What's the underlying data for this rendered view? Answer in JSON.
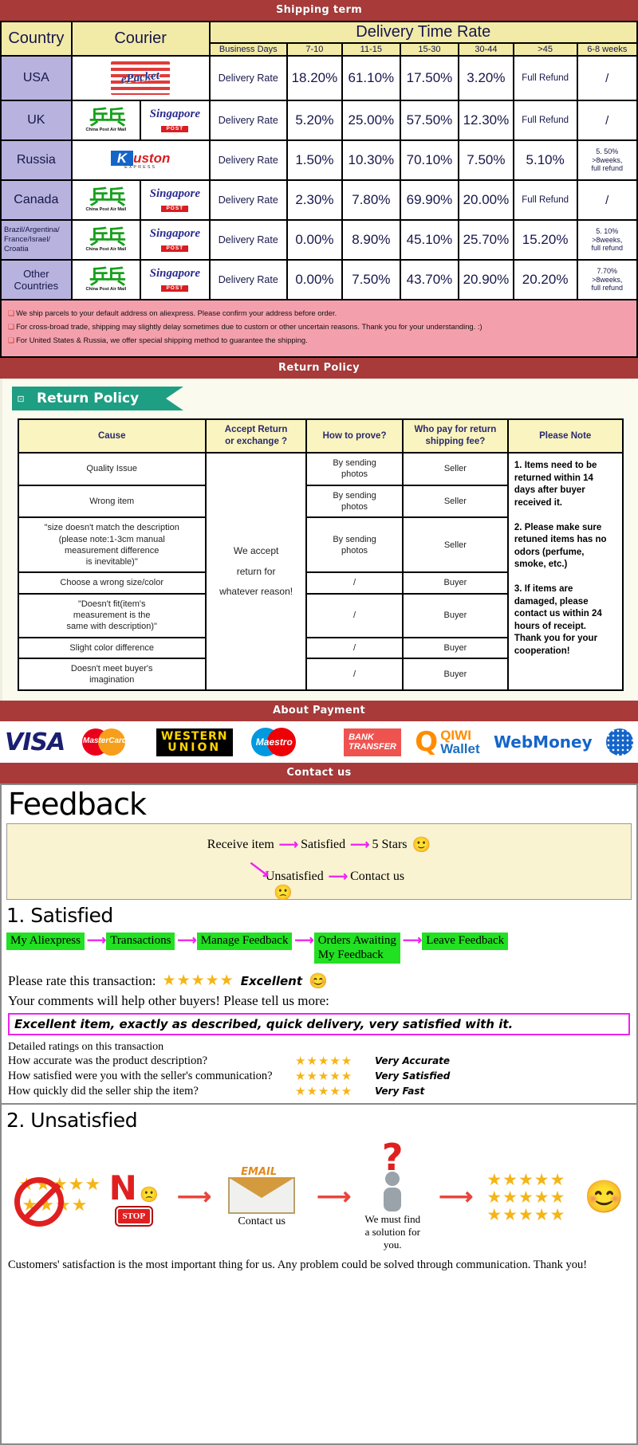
{
  "sections": {
    "shipping_banner": "Shipping term",
    "return_banner": "Return Policy",
    "payment_banner": "About Payment",
    "contact_banner": "Contact us"
  },
  "shipping": {
    "headers": {
      "country": "Country",
      "courier": "Courier",
      "delivery_time_rate": "Delivery Time Rate",
      "business_days": "Business Days",
      "d1": "7-10",
      "d2": "11-15",
      "d3": "15-30",
      "d4": "30-44",
      "d5": ">45",
      "d6": "6-8 weeks"
    },
    "rate_label": "Delivery Rate",
    "rows": [
      {
        "country": "USA",
        "couriers": [
          "epacket"
        ],
        "values": [
          "18.20%",
          "61.10%",
          "17.50%",
          "3.20%",
          "Full Refund",
          "/"
        ]
      },
      {
        "country": "UK",
        "couriers": [
          "china-post-air-mail",
          "singapore-post"
        ],
        "values": [
          "5.20%",
          "25.00%",
          "57.50%",
          "12.30%",
          "Full Refund",
          "/"
        ]
      },
      {
        "country": "Russia",
        "couriers": [
          "kuston-express"
        ],
        "values": [
          "1.50%",
          "10.30%",
          "70.10%",
          "7.50%",
          "5.10%",
          "5. 50%\n>8weeks,\nfull refund"
        ]
      },
      {
        "country": "Canada",
        "couriers": [
          "china-post-air-mail",
          "singapore-post"
        ],
        "values": [
          "2.30%",
          "7.80%",
          "69.90%",
          "20.00%",
          "Full Refund",
          "/"
        ]
      },
      {
        "country": "Brazil/Argentina/\nFrance/Israel/\nCroatia",
        "couriers": [
          "china-post-air-mail",
          "singapore-post"
        ],
        "values": [
          "0.00%",
          "8.90%",
          "45.10%",
          "25.70%",
          "15.20%",
          "5. 10%\n>8weeks,\nfull refund"
        ]
      },
      {
        "country": "Other Countries",
        "couriers": [
          "china-post-air-mail",
          "singapore-post"
        ],
        "values": [
          "0.00%",
          "7.50%",
          "43.70%",
          "20.90%",
          "20.20%",
          "7.70%\n>8weeks,\nfull refund"
        ]
      }
    ],
    "notice": [
      "We ship parcels to your default address on aliexpress. Please confirm your address before order.",
      "For cross-broad trade, shipping may slightly delay sometimes due to custom or other uncertain reasons. Thank you for your understanding. :)",
      "For United States & Russia, we offer special shipping method to guarantee the shipping."
    ]
  },
  "return_policy": {
    "tab_label": "Return Policy",
    "headers": [
      "Cause",
      "Accept Return\nor exchange ?",
      "How to prove?",
      "Who pay for return\nshipping fee?",
      "Please Note"
    ],
    "accept_text": "We accept\nreturn for\nwhatever reason!",
    "rows": [
      {
        "cause": "Quality Issue",
        "prove": "By sending\nphotos",
        "who": "Seller"
      },
      {
        "cause": "Wrong item",
        "prove": "By sending\nphotos",
        "who": "Seller"
      },
      {
        "cause": "\"size doesn't match the description\n(please note:1-3cm manual\nmeasurement difference\nis inevitable)\"",
        "prove": "By sending\nphotos",
        "who": "Seller"
      },
      {
        "cause": "Choose a wrong size/color",
        "prove": "/",
        "who": "Buyer"
      },
      {
        "cause": "\"Doesn't fit(item's\nmeasurement is the\nsame with description)\"",
        "prove": "/",
        "who": "Buyer"
      },
      {
        "cause": "Slight color difference",
        "prove": "/",
        "who": "Buyer"
      },
      {
        "cause": "Doesn't meet buyer's\nimagination",
        "prove": "/",
        "who": "Buyer"
      }
    ],
    "note": "1. Items need to be returned within 14 days after buyer received it.\n\n2. Please make sure retuned items has no odors (perfume, smoke, etc.)\n\n3. If items are damaged, please contact us within 24 hours of receipt.\nThank you for your cooperation!"
  },
  "payment": {
    "methods": [
      {
        "name": "visa-logo",
        "label": "VISA"
      },
      {
        "name": "mastercard-logo",
        "label": "MasterCard"
      },
      {
        "name": "western-union-logo",
        "label1": "WESTERN",
        "label2": "UNION"
      },
      {
        "name": "maestro-logo",
        "label": "Maestro"
      },
      {
        "name": "bank-transfer-logo",
        "label1": "BANK",
        "label2": "TRANSFER"
      },
      {
        "name": "qiwi-wallet-logo",
        "label1": "QIWI",
        "label2": "Wallet"
      },
      {
        "name": "webmoney-logo",
        "label": "WebMoney"
      }
    ]
  },
  "feedback": {
    "title": "Feedback",
    "flow": {
      "receive_item": "Receive item",
      "satisfied": "Satisfied",
      "five_stars": "5 Stars",
      "unsatisfied": "Unsatisfied",
      "contact_us": "Contact us"
    },
    "satisfied_heading": "1. Satisfied",
    "green_steps": [
      "My Aliexpress",
      "Transactions",
      "Manage Feedback",
      "Orders Awaiting\nMy Feedback",
      "Leave Feedback"
    ],
    "rate_prompt": "Please rate this transaction:",
    "rate_stars": "★★★★★",
    "rate_word": "Excellent",
    "comments_prompt": "Your comments will help other buyers! Please tell us more:",
    "comment_example": "Excellent item, exactly as described, quick delivery, very satisfied with it.",
    "detailed_heading": "Detailed ratings on this transaction",
    "detailed_rows": [
      {
        "question": "How accurate was the product description?",
        "stars": "★★★★★",
        "value": "Very Accurate"
      },
      {
        "question": "How satisfied were you with the seller's communication?",
        "stars": "★★★★★",
        "value": "Very Satisfied"
      },
      {
        "question": "How quickly did the seller ship the item?",
        "stars": "★★★★★",
        "value": "Very Fast"
      }
    ],
    "unsatisfied_heading": "2. Unsatisfied",
    "unsat_flow": {
      "no_label": "N",
      "stop_label": "STOP",
      "email_label": "EMAIL",
      "contact_us": "Contact us",
      "solution": "We must find\na solution for\nyou.",
      "stars_block": "★★★★★\n★★★★★\n★★★★★"
    },
    "footer": "Customers' satisfaction is the most important thing for us. Any problem could be solved through communication. Thank you!"
  }
}
